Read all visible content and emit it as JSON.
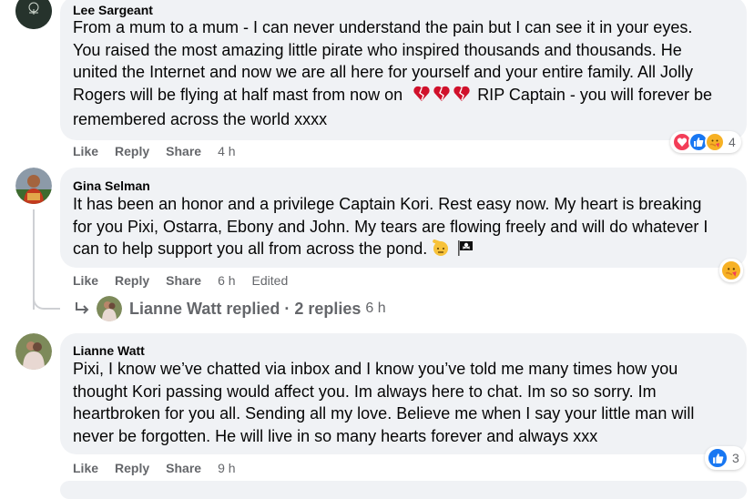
{
  "comments": [
    {
      "author": "Lee Sargeant",
      "lines": [
        "From a mum to a mum - I can never understand the pain but I can see it in your eyes.",
        "You raised the most amazing little pirate who inspired thousands and thousands. He",
        "united the Internet and now we are all here for yourself and your entire family. All Jolly",
        "Rogers will be flying at half mast from now on",
        " RIP Captain - you will forever be",
        "remembered across the world xxxx"
      ],
      "actions": {
        "like": "Like",
        "reply": "Reply",
        "share": "Share",
        "time": "4 h"
      },
      "reactions": {
        "count": "4",
        "icons": [
          "love-icon",
          "like-icon",
          "care-icon"
        ]
      }
    },
    {
      "author": "Gina Selman",
      "lines": [
        "It has been an honor and a privilege Captain Kori. Rest easy now. My heart is breaking",
        "for you Pixi, Ostarra, Ebony and John. My tears are flowing freely and will do whatever I",
        "can to help support you all from across the pond."
      ],
      "actions": {
        "like": "Like",
        "reply": "Reply",
        "share": "Share",
        "time": "6 h",
        "edited": "Edited"
      },
      "reactions": {
        "icons": [
          "care-icon"
        ]
      },
      "replies_link": {
        "text": "Lianne Watt replied · 2 replies",
        "time": "6 h"
      }
    },
    {
      "author": "Lianne Watt",
      "lines": [
        "Pixi, I know we’ve chatted via inbox and I know you’ve told me many times how you",
        "thought Kori passing would affect you. Im always here to chat. Im so so sorry. Im",
        "heartbroken for you all. Sending all my love. Believe me when I say your little man will",
        "never be forgotten. He will live in so many hearts forever and always xxx"
      ],
      "actions": {
        "like": "Like",
        "reply": "Reply",
        "share": "Share",
        "time": "9 h"
      },
      "reactions": {
        "count": "3",
        "icons": [
          "like-icon"
        ]
      }
    }
  ],
  "colors": {
    "bubble": "#f0f2f5",
    "meta": "#65676b",
    "like": "#1877f2",
    "love": "#f33e58",
    "care": "#f7b125"
  }
}
